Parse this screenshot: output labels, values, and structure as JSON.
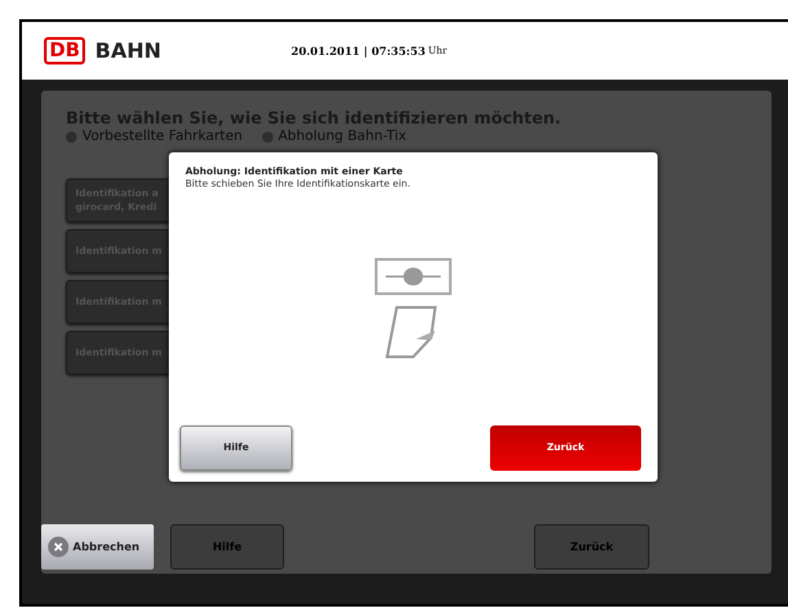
{
  "header": {
    "logo_mark": "DB",
    "logo_text": "BAHN",
    "datetime": "20.01.2011 | 07:35:53",
    "datetime_unit": "Uhr"
  },
  "background": {
    "heading": "Bitte wählen Sie, wie Sie sich identifizieren möchten.",
    "options": [
      {
        "label": "Vorbestellte Fahrkarten"
      },
      {
        "label": "Abholung Bahn-Tix"
      }
    ],
    "choices": [
      {
        "lines": [
          "Identifikation a",
          "girocard, Kredi"
        ]
      },
      {
        "lines": [
          "Identifikation m"
        ]
      },
      {
        "lines": [
          "Identifikation m"
        ]
      },
      {
        "lines": [
          "Identifikation m"
        ]
      }
    ]
  },
  "footer": {
    "cancel": "Abbrechen",
    "help": "Hilfe",
    "back": "Zurück"
  },
  "dialog": {
    "title": "Abholung: Identifikation mit einer Karte",
    "message": "Bitte schieben Sie Ihre Identifikationskarte ein.",
    "help": "Hilfe",
    "back": "Zurück"
  }
}
